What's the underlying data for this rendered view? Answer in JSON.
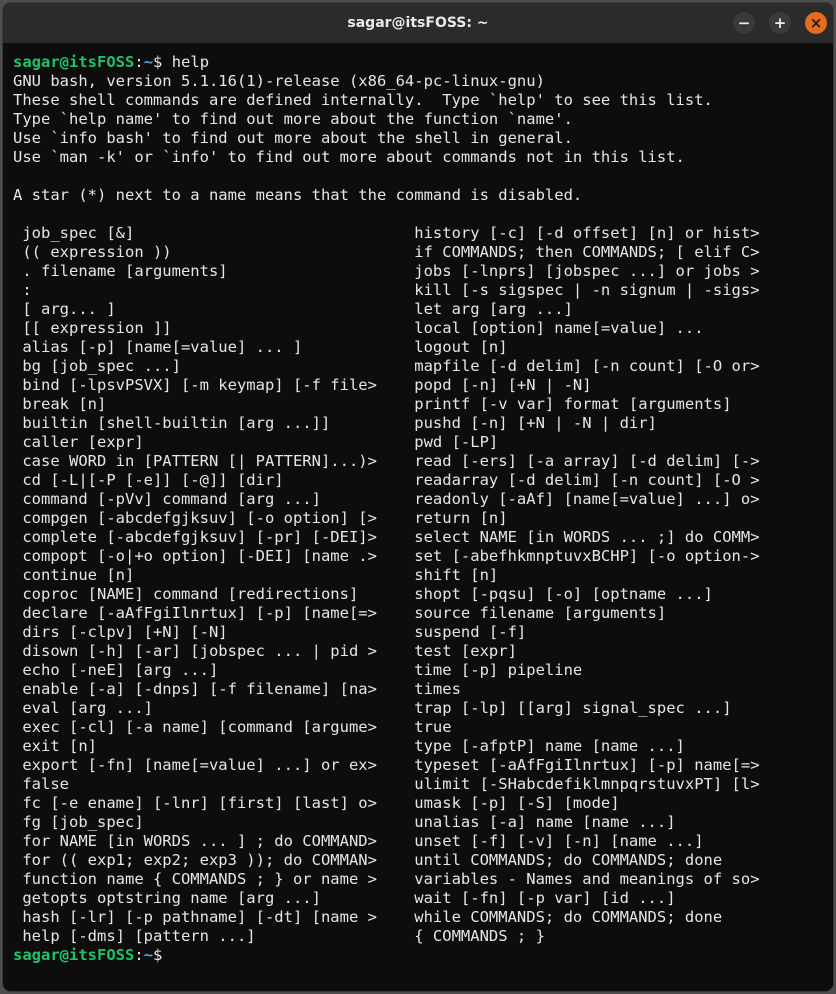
{
  "window": {
    "title": "sagar@itsFOSS: ~"
  },
  "controls": {
    "min": "−",
    "max": "+",
    "close": "×"
  },
  "prompt": {
    "user": "sagar",
    "at": "@",
    "host": "itsFOSS",
    "colon": ":",
    "path": "~",
    "dollar": "$"
  },
  "command": "help",
  "header_lines": [
    "GNU bash, version 5.1.16(1)-release (x86_64-pc-linux-gnu)",
    "These shell commands are defined internally.  Type `help' to see this list.",
    "Type `help name' to find out more about the function `name'.",
    "Use `info bash' to find out more about the shell in general.",
    "Use `man -k' or `info' to find out more about commands not in this list.",
    "",
    "A star (*) next to a name means that the command is disabled.",
    ""
  ],
  "builtin_rows": [
    {
      "left": " job_spec [&]",
      "right": "history [-c] [-d offset] [n] or hist>"
    },
    {
      "left": " (( expression ))",
      "right": "if COMMANDS; then COMMANDS; [ elif C>"
    },
    {
      "left": " . filename [arguments]",
      "right": "jobs [-lnprs] [jobspec ...] or jobs >"
    },
    {
      "left": " :",
      "right": "kill [-s sigspec | -n signum | -sigs>"
    },
    {
      "left": " [ arg... ]",
      "right": "let arg [arg ...]"
    },
    {
      "left": " [[ expression ]]",
      "right": "local [option] name[=value] ..."
    },
    {
      "left": " alias [-p] [name[=value] ... ]",
      "right": "logout [n]"
    },
    {
      "left": " bg [job_spec ...]",
      "right": "mapfile [-d delim] [-n count] [-O or>"
    },
    {
      "left": " bind [-lpsvPSVX] [-m keymap] [-f file>",
      "right": "popd [-n] [+N | -N]"
    },
    {
      "left": " break [n]",
      "right": "printf [-v var] format [arguments]"
    },
    {
      "left": " builtin [shell-builtin [arg ...]]",
      "right": "pushd [-n] [+N | -N | dir]"
    },
    {
      "left": " caller [expr]",
      "right": "pwd [-LP]"
    },
    {
      "left": " case WORD in [PATTERN [| PATTERN]...)>",
      "right": "read [-ers] [-a array] [-d delim] [->"
    },
    {
      "left": " cd [-L|[-P [-e]] [-@]] [dir]",
      "right": "readarray [-d delim] [-n count] [-O >"
    },
    {
      "left": " command [-pVv] command [arg ...]",
      "right": "readonly [-aAf] [name[=value] ...] o>"
    },
    {
      "left": " compgen [-abcdefgjksuv] [-o option] [>",
      "right": "return [n]"
    },
    {
      "left": " complete [-abcdefgjksuv] [-pr] [-DEI]>",
      "right": "select NAME [in WORDS ... ;] do COMM>"
    },
    {
      "left": " compopt [-o|+o option] [-DEI] [name .>",
      "right": "set [-abefhkmnptuvxBCHP] [-o option->"
    },
    {
      "left": " continue [n]",
      "right": "shift [n]"
    },
    {
      "left": " coproc [NAME] command [redirections]",
      "right": "shopt [-pqsu] [-o] [optname ...]"
    },
    {
      "left": " declare [-aAfFgiIlnrtux] [-p] [name[=>",
      "right": "source filename [arguments]"
    },
    {
      "left": " dirs [-clpv] [+N] [-N]",
      "right": "suspend [-f]"
    },
    {
      "left": " disown [-h] [-ar] [jobspec ... | pid >",
      "right": "test [expr]"
    },
    {
      "left": " echo [-neE] [arg ...]",
      "right": "time [-p] pipeline"
    },
    {
      "left": " enable [-a] [-dnps] [-f filename] [na>",
      "right": "times"
    },
    {
      "left": " eval [arg ...]",
      "right": "trap [-lp] [[arg] signal_spec ...]"
    },
    {
      "left": " exec [-cl] [-a name] [command [argume>",
      "right": "true"
    },
    {
      "left": " exit [n]",
      "right": "type [-afptP] name [name ...]"
    },
    {
      "left": " export [-fn] [name[=value] ...] or ex>",
      "right": "typeset [-aAfFgiIlnrtux] [-p] name[=>"
    },
    {
      "left": " false",
      "right": "ulimit [-SHabcdefiklmnpqrstuvxPT] [l>"
    },
    {
      "left": " fc [-e ename] [-lnr] [first] [last] o>",
      "right": "umask [-p] [-S] [mode]"
    },
    {
      "left": " fg [job_spec]",
      "right": "unalias [-a] name [name ...]"
    },
    {
      "left": " for NAME [in WORDS ... ] ; do COMMAND>",
      "right": "unset [-f] [-v] [-n] [name ...]"
    },
    {
      "left": " for (( exp1; exp2; exp3 )); do COMMAN>",
      "right": "until COMMANDS; do COMMANDS; done"
    },
    {
      "left": " function name { COMMANDS ; } or name >",
      "right": "variables - Names and meanings of so>"
    },
    {
      "left": " getopts optstring name [arg ...]",
      "right": "wait [-fn] [-p var] [id ...]"
    },
    {
      "left": " hash [-lr] [-p pathname] [-dt] [name >",
      "right": "while COMMANDS; do COMMANDS; done"
    },
    {
      "left": " help [-dms] [pattern ...]",
      "right": "{ COMMANDS ; }"
    }
  ]
}
